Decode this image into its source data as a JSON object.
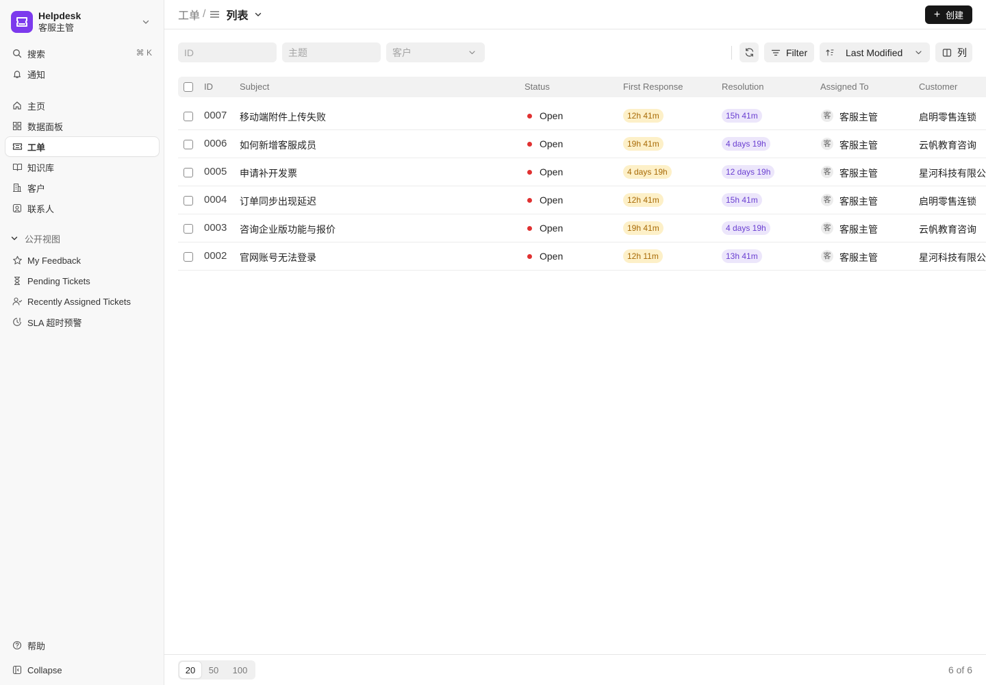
{
  "brand": {
    "name": "Helpdesk",
    "subtitle": "客服主管",
    "color": "#7c3aed"
  },
  "sidebar": {
    "utility": [
      {
        "label": "搜索",
        "icon": "search-icon",
        "shortcut": "⌘ K"
      },
      {
        "label": "通知",
        "icon": "bell-icon"
      }
    ],
    "nav": [
      {
        "label": "主页",
        "icon": "home-icon"
      },
      {
        "label": "数据面板",
        "icon": "dashboard-icon"
      },
      {
        "label": "工单",
        "icon": "ticket-icon",
        "active": true
      },
      {
        "label": "知识库",
        "icon": "book-icon"
      },
      {
        "label": "客户",
        "icon": "building-icon"
      },
      {
        "label": "联系人",
        "icon": "contact-icon"
      }
    ],
    "section_title": "公开视图",
    "views": [
      {
        "label": "My Feedback",
        "icon": "star-icon"
      },
      {
        "label": "Pending Tickets",
        "icon": "hourglass-icon"
      },
      {
        "label": "Recently Assigned Tickets",
        "icon": "user-check-icon"
      },
      {
        "label": "SLA 超时预警",
        "icon": "clock-alert-icon"
      }
    ],
    "help_label": "帮助",
    "collapse_label": "Collapse"
  },
  "header": {
    "breadcrumb_root": "工单",
    "breadcrumb_sep": "/",
    "view_label": "列表",
    "create_label": "创建"
  },
  "filters": {
    "id_placeholder": "ID",
    "subject_placeholder": "主题",
    "customer_placeholder": "客户"
  },
  "toolbar": {
    "filter_label": "Filter",
    "sort_label": "Last Modified",
    "columns_label": "列"
  },
  "table": {
    "columns": [
      "ID",
      "Subject",
      "Status",
      "First Response",
      "Resolution",
      "Assigned To",
      "Customer"
    ],
    "rows": [
      {
        "id": "0007",
        "subject": "移动端附件上传失败",
        "status": "Open",
        "first_response": "12h 41m",
        "resolution": "15h 41m",
        "assignee_initial": "客",
        "assignee": "客服主管",
        "customer": "启明零售连锁"
      },
      {
        "id": "0006",
        "subject": "如何新增客服成员",
        "status": "Open",
        "first_response": "19h 41m",
        "resolution": "4 days 19h",
        "assignee_initial": "客",
        "assignee": "客服主管",
        "customer": "云帆教育咨询"
      },
      {
        "id": "0005",
        "subject": "申请补开发票",
        "status": "Open",
        "first_response": "4 days 19h",
        "resolution": "12 days 19h",
        "assignee_initial": "客",
        "assignee": "客服主管",
        "customer": "星河科技有限公司"
      },
      {
        "id": "0004",
        "subject": "订单同步出现延迟",
        "status": "Open",
        "first_response": "12h 41m",
        "resolution": "15h 41m",
        "assignee_initial": "客",
        "assignee": "客服主管",
        "customer": "启明零售连锁"
      },
      {
        "id": "0003",
        "subject": "咨询企业版功能与报价",
        "status": "Open",
        "first_response": "19h 41m",
        "resolution": "4 days 19h",
        "assignee_initial": "客",
        "assignee": "客服主管",
        "customer": "云帆教育咨询"
      },
      {
        "id": "0002",
        "subject": "官网账号无法登录",
        "status": "Open",
        "first_response": "12h 11m",
        "resolution": "13h 41m",
        "assignee_initial": "客",
        "assignee": "客服主管",
        "customer": "星河科技有限公司"
      }
    ],
    "status_color": "#e03131"
  },
  "footer": {
    "page_sizes": [
      "20",
      "50",
      "100"
    ],
    "selected_page_size": "20",
    "count_text": "6 of 6"
  }
}
